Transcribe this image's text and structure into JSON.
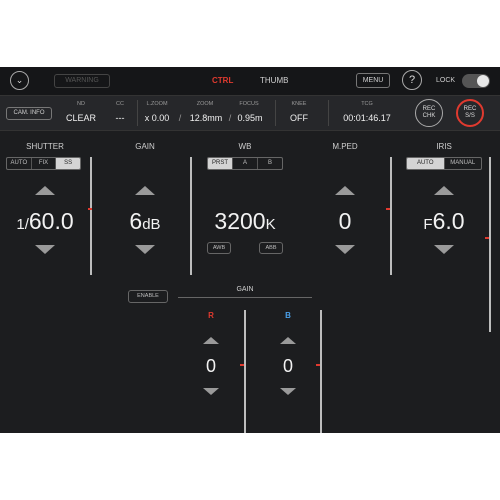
{
  "topbar": {
    "warning_label": "WARNING",
    "tab_ctrl": "CTRL",
    "tab_thumb": "THUMB",
    "menu_label": "MENU",
    "help_label": "?",
    "lock_label": "LOCK"
  },
  "infobar": {
    "cam_info": "CAM. INFO",
    "nd": {
      "label": "ND",
      "value": "CLEAR"
    },
    "cc": {
      "label": "CC",
      "value": "---"
    },
    "lzoom": {
      "label": "L.ZOOM",
      "value": "x 0.00"
    },
    "zoom": {
      "label": "ZOOM",
      "value": "12.8mm"
    },
    "focus": {
      "label": "FOCUS",
      "value": "0.95m"
    },
    "knee": {
      "label": "KNEE",
      "value": "OFF"
    },
    "tcg": {
      "label": "TCG",
      "value": "00:01:46.17"
    },
    "sep1": "/",
    "sep2": "/",
    "rec_chk": "REC\nCHK",
    "rec_ss": "REC\nS/S"
  },
  "shutter": {
    "title": "SHUTTER",
    "modes": [
      "AUTO",
      "FIX",
      "SS"
    ],
    "value_prefix": "1/",
    "value": "60.0"
  },
  "gain": {
    "title": "GAIN",
    "value": "6",
    "unit": "dB"
  },
  "wb": {
    "title": "WB",
    "modes": [
      "PRST",
      "A",
      "B"
    ],
    "value": "3200",
    "unit": "K",
    "awb": "AWB",
    "abb": "ABB"
  },
  "mped": {
    "title": "M.PED",
    "value": "0"
  },
  "iris": {
    "title": "IRIS",
    "modes": [
      "AUTO",
      "MANUAL"
    ],
    "prefix": "F",
    "value": "6.0"
  },
  "rb_gain": {
    "enable": "ENABLE",
    "title": "GAIN",
    "r_label": "R",
    "b_label": "B",
    "r_value": "0",
    "b_value": "0"
  },
  "colors": {
    "accent_red": "#e03a2f",
    "b_blue": "#4aa0e8"
  }
}
